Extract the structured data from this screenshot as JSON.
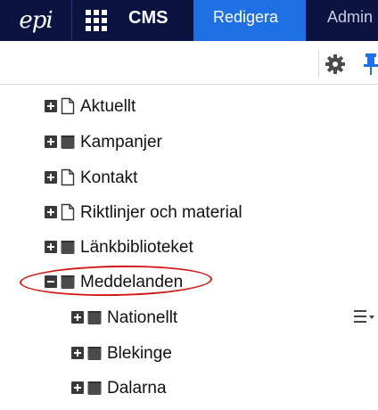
{
  "topbar": {
    "logo": "epi",
    "app_title": "CMS",
    "tabs": [
      {
        "label": "Redigera",
        "active": true
      },
      {
        "label": "Admin",
        "active": false
      }
    ],
    "colors": {
      "bar": "#0b1340",
      "active_tab": "#1f6fe5"
    }
  },
  "toolbar": {
    "icons": [
      "gear-icon",
      "pin-icon"
    ]
  },
  "tree": {
    "items": [
      {
        "label": "Aktuellt",
        "icon": "page-icon",
        "expander": "plus",
        "level": 0
      },
      {
        "label": "Kampanjer",
        "icon": "folder-icon",
        "expander": "plus",
        "level": 0
      },
      {
        "label": "Kontakt",
        "icon": "page-icon",
        "expander": "plus",
        "level": 0
      },
      {
        "label": "Riktlinjer och material",
        "icon": "page-icon",
        "expander": "plus",
        "level": 0
      },
      {
        "label": "Länkbiblioteket",
        "icon": "folder-icon",
        "expander": "plus",
        "level": 0
      },
      {
        "label": "Meddelanden",
        "icon": "folder-icon",
        "expander": "minus",
        "level": 0,
        "highlighted": true
      },
      {
        "label": "Nationellt",
        "icon": "folder-icon",
        "expander": "plus",
        "level": 1,
        "context_menu": true
      },
      {
        "label": "Blekinge",
        "icon": "folder-icon",
        "expander": "plus",
        "level": 1
      },
      {
        "label": "Dalarna",
        "icon": "folder-icon",
        "expander": "plus",
        "level": 1
      }
    ]
  }
}
